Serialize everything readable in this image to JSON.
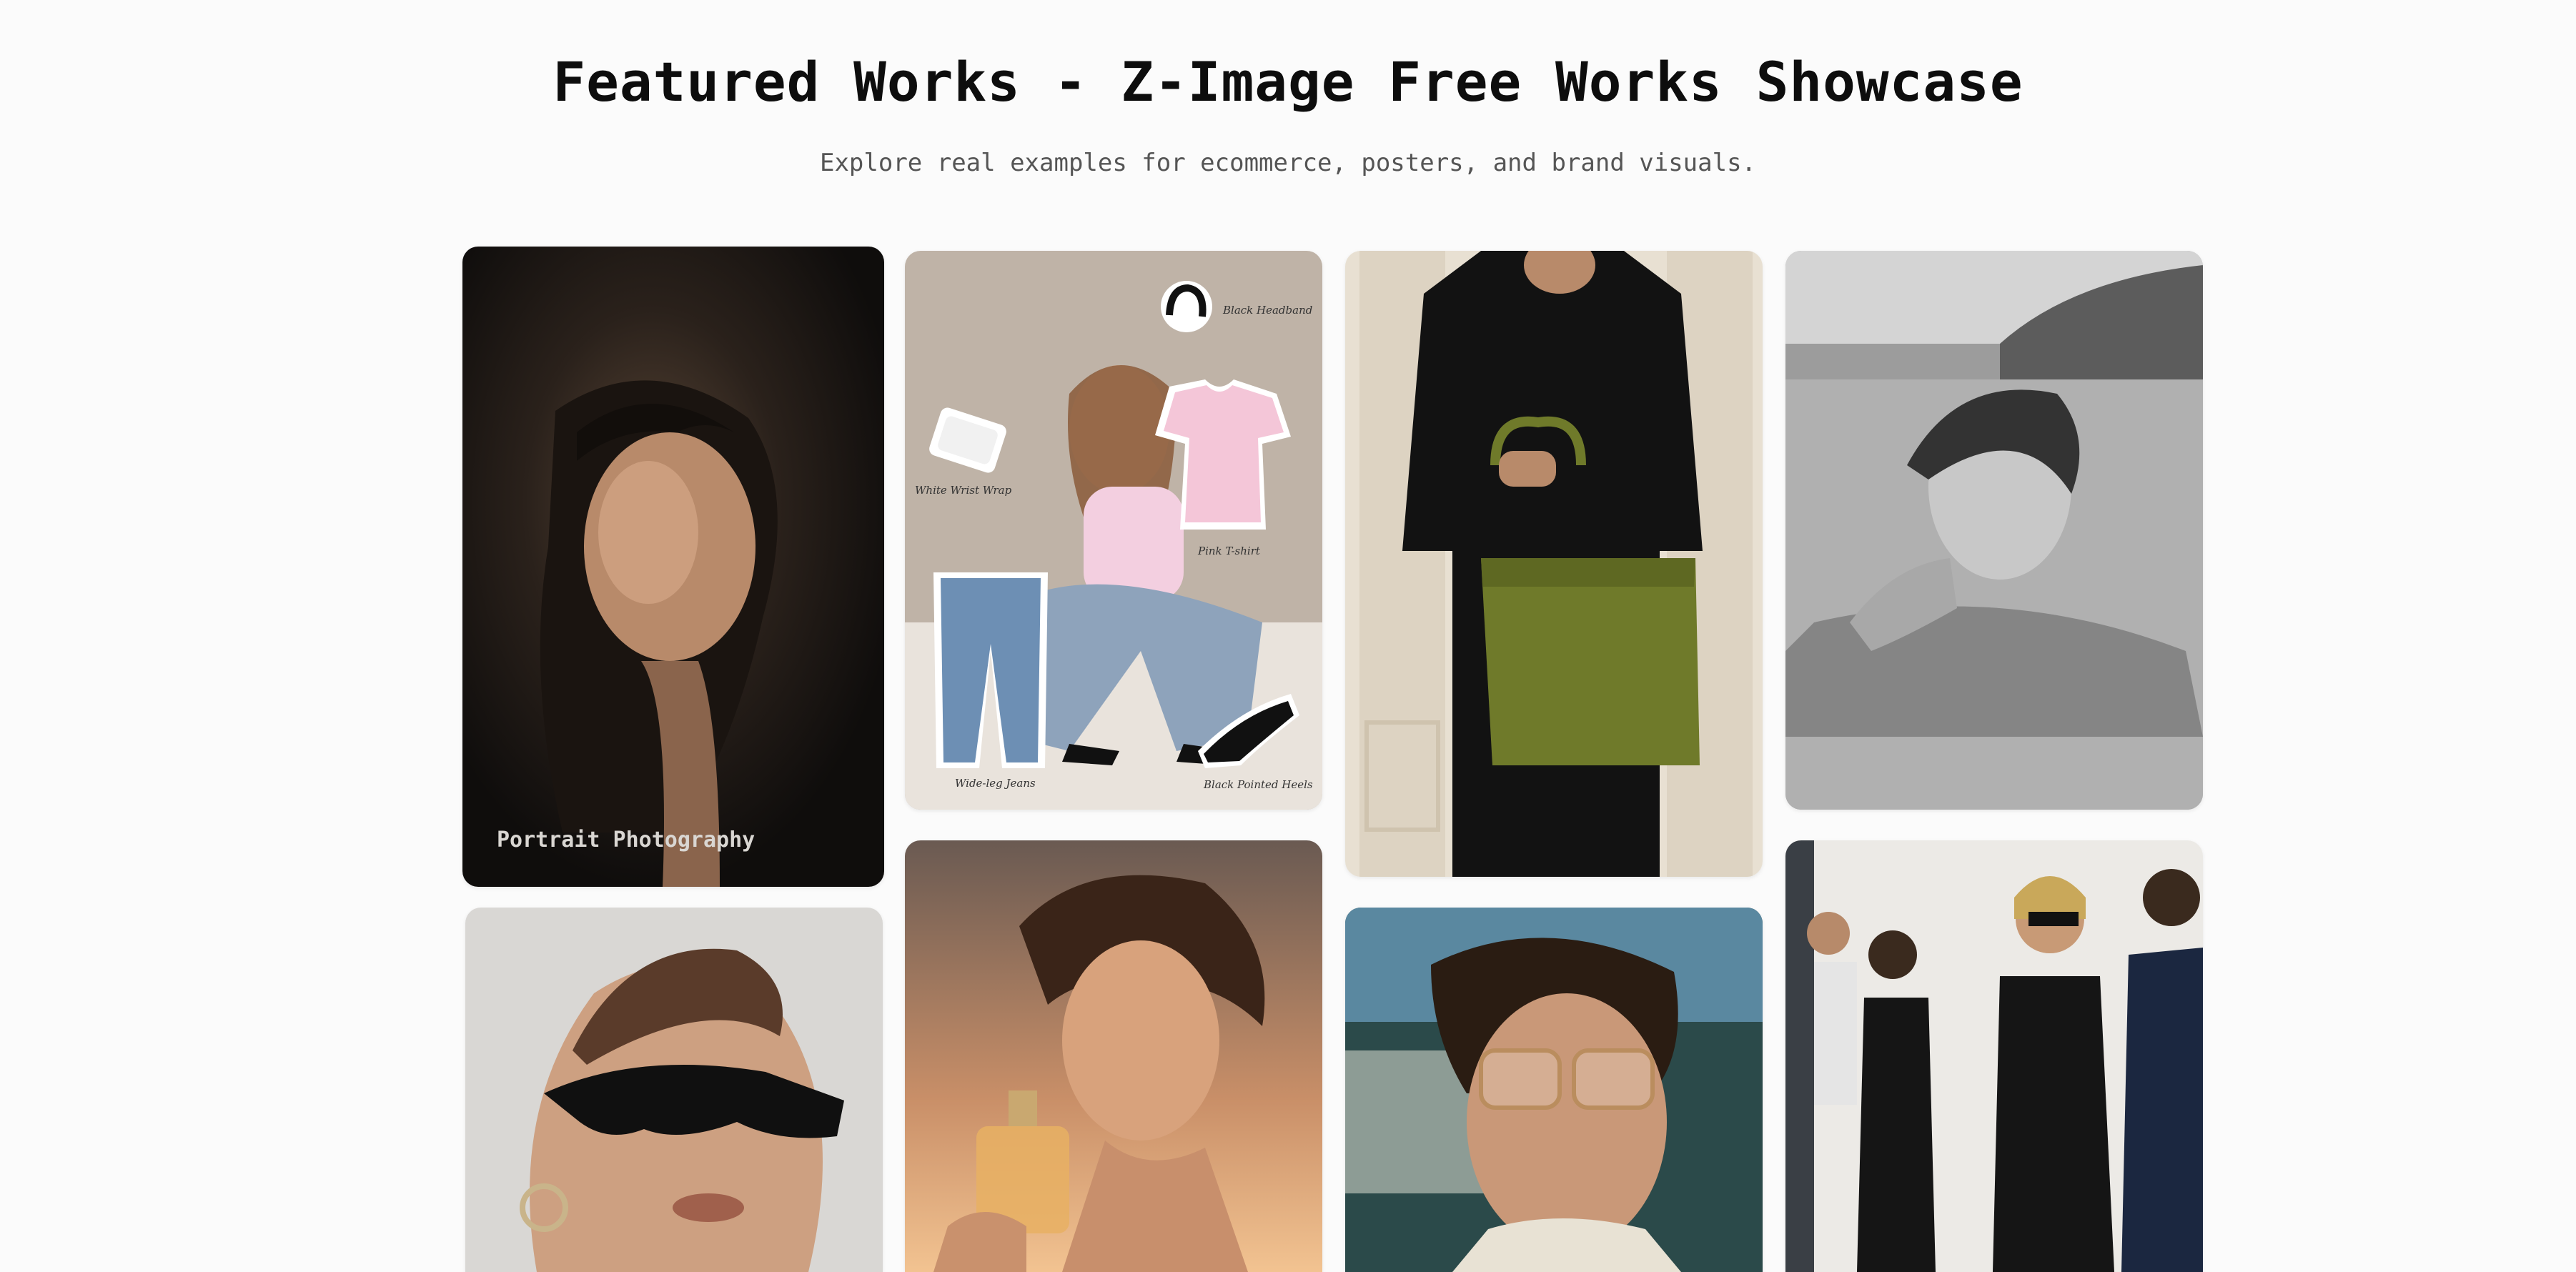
{
  "header": {
    "title": "Featured Works - Z-Image Free Works Showcase",
    "subtitle": "Explore real examples for ecommerce, posters, and brand visuals."
  },
  "gallery": {
    "items": [
      {
        "caption": "Portrait Photography",
        "subject": "dark portrait of woman with wavy hair"
      },
      {
        "subject": "outfit flat-lay with sitting girl",
        "stickers": [
          "Black Headband",
          "White Wrist Wrap",
          "Pink T-shirt",
          "Wide-leg Jeans",
          "Black Pointed Heels"
        ]
      },
      {
        "subject": "woman in black dress holding olive green tote bag"
      },
      {
        "subject": "black and white portrait on sandy beach"
      },
      {
        "subject": "woman wearing black sunglasses and hoop earring"
      },
      {
        "subject": "woman holding perfume bottle at sunset"
      },
      {
        "subject": "man in tinted aviator glasses"
      },
      {
        "subject": "street fashion group walking"
      }
    ]
  },
  "colors": {
    "background": "#fbfbfb",
    "title": "#0d0d0d",
    "subtitle": "#555555",
    "tote": "#6f7a2a"
  }
}
